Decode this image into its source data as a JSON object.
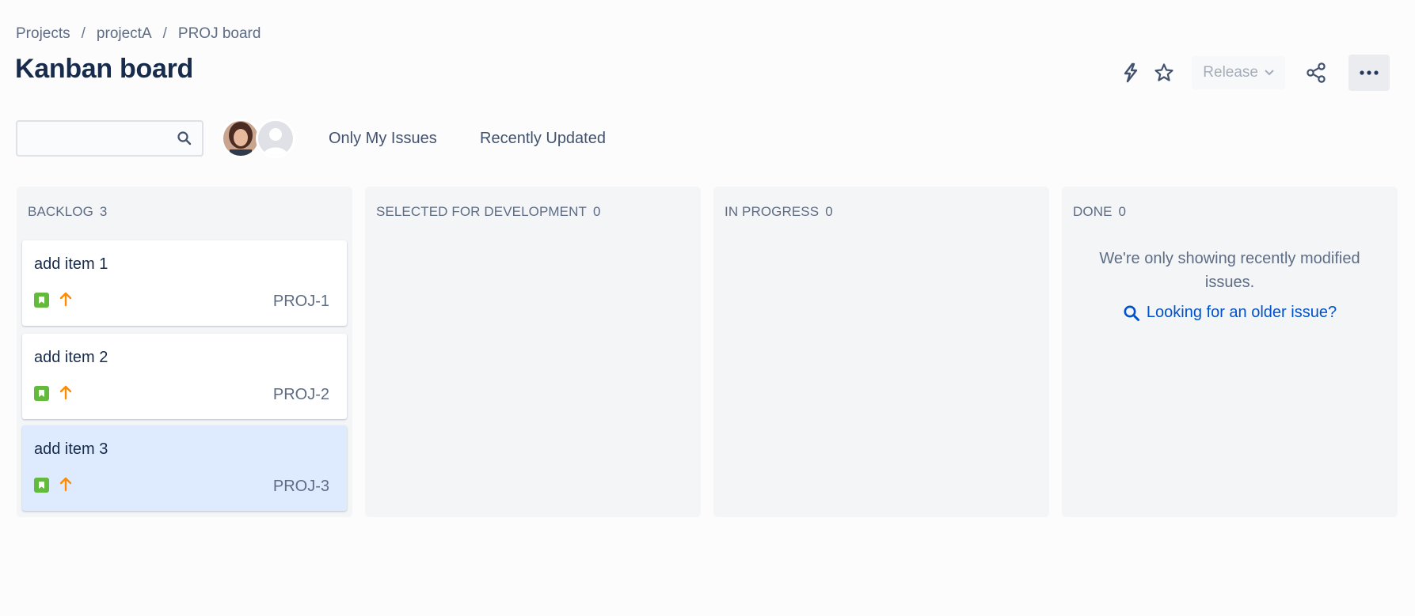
{
  "breadcrumb": [
    "Projects",
    "projectA",
    "PROJ board"
  ],
  "page_title": "Kanban board",
  "actions": {
    "release_label": "Release"
  },
  "search": {
    "value": "",
    "placeholder": ""
  },
  "filters": {
    "only_my_issues": "Only My Issues",
    "recently_updated": "Recently Updated"
  },
  "columns": [
    {
      "title": "BACKLOG",
      "count": "3",
      "cards": [
        {
          "title": "add item 1",
          "key": "PROJ-1",
          "selected": false
        },
        {
          "title": "add item 2",
          "key": "PROJ-2",
          "selected": false
        },
        {
          "title": "add item 3",
          "key": "PROJ-3",
          "selected": true
        }
      ]
    },
    {
      "title": "SELECTED FOR DEVELOPMENT",
      "count": "0",
      "cards": []
    },
    {
      "title": "IN PROGRESS",
      "count": "0",
      "cards": []
    },
    {
      "title": "DONE",
      "count": "0",
      "cards": [],
      "message": "We're only showing recently modified issues.",
      "link": "Looking for an older issue?"
    }
  ],
  "colors": {
    "story_type": "#63ba3c",
    "priority_high": "#ff8b00",
    "link": "#0052cc",
    "selected_card": "#deebff"
  },
  "icons": {
    "card_type": "story-icon",
    "card_priority": "priority-high-icon"
  }
}
